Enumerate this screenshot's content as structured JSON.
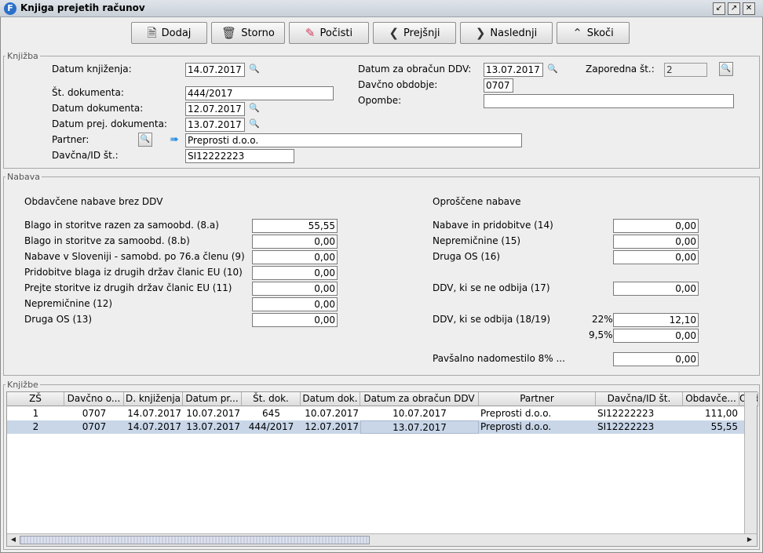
{
  "window": {
    "title": "Knjiga prejetih računov",
    "app_icon_letter": "F"
  },
  "toolbar": {
    "add_label": "Dodaj",
    "storno_label": "Storno",
    "clear_label": "Počisti",
    "prev_label": "Prejšnji",
    "next_label": "Naslednji",
    "jump_label": "Skoči"
  },
  "knjizba": {
    "legend": "Knjižba",
    "datum_knjizenja_label": "Datum knjiženja:",
    "datum_knjizenja": "14.07.2017",
    "st_dokumenta_label": "Št. dokumenta:",
    "st_dokumenta": "444/2017",
    "datum_dokumenta_label": "Datum dokumenta:",
    "datum_dokumenta": "12.07.2017",
    "datum_prej_label": "Datum prej. dokumenta:",
    "datum_prej": "13.07.2017",
    "partner_label": "Partner:",
    "partner": "Preprosti d.o.o.",
    "davcna_label": "Davčna/ID št.:",
    "davcna": "SI12222223",
    "datum_ddv_label": "Datum za obračun DDV:",
    "datum_ddv": "13.07.2017",
    "zaporedna_label": "Zaporedna št.:",
    "zaporedna": "2",
    "obdobje_label": "Davčno obdobje:",
    "obdobje": "0707",
    "opombe_label": "Opombe:",
    "opombe": ""
  },
  "nabava": {
    "legend": "Nabava",
    "left_title": "Obdavčene nabave brez DDV",
    "right_title": "Oproščene nabave",
    "left_rows": [
      {
        "label": "Blago in storitve razen za samoobd. (8.a)",
        "value": "55,55"
      },
      {
        "label": "Blago in storitve za samoobd. (8.b)",
        "value": "0,00"
      },
      {
        "label": "Nabave v Sloveniji - samobd. po 76.a členu (9)",
        "value": "0,00"
      },
      {
        "label": "Pridobitve blaga iz drugih držav članic EU (10)",
        "value": "0,00"
      },
      {
        "label": "Prejte storitve iz drugih držav članic EU (11)",
        "value": "0,00"
      },
      {
        "label": "Nepremičnine (12)",
        "value": "0,00"
      },
      {
        "label": "Druga OS (13)",
        "value": "0,00"
      }
    ],
    "right_rows": [
      {
        "label": "Nabave in pridobitve (14)",
        "value": "0,00"
      },
      {
        "label": "Nepremičnine (15)",
        "value": "0,00"
      },
      {
        "label": "Druga OS (16)",
        "value": "0,00"
      }
    ],
    "ne_odbija_label": "DDV, ki se ne odbija (17)",
    "ne_odbija": "0,00",
    "odbija_label": "DDV, ki se odbija (18/19)",
    "rate1": "22%",
    "odbija_22": "12,10",
    "rate2": "9,5%",
    "odbija_95": "0,00",
    "pavsal_label": "Pavšalno nadomestilo 8% ...",
    "pavsal": "0,00"
  },
  "knjizbe": {
    "legend": "Knjižbe",
    "columns": [
      "ZŠ",
      "Davčno o...",
      "D. knjiženja",
      "Datum pr...",
      "Št. dok.",
      "Datum dok.",
      "Datum za obračun DDV",
      "Partner",
      "Davčna/ID št.",
      "Obdavče...",
      "Obd"
    ],
    "rows": [
      [
        "1",
        "0707",
        "14.07.2017",
        "10.07.2017",
        "645",
        "10.07.2017",
        "10.07.2017",
        "Preprosti d.o.o.",
        "SI12222223",
        "111,00",
        ""
      ],
      [
        "2",
        "0707",
        "14.07.2017",
        "13.07.2017",
        "444/2017",
        "12.07.2017",
        "13.07.2017",
        "Preprosti d.o.o.",
        "SI12222223",
        "55,55",
        ""
      ]
    ],
    "selected_row": 1
  }
}
